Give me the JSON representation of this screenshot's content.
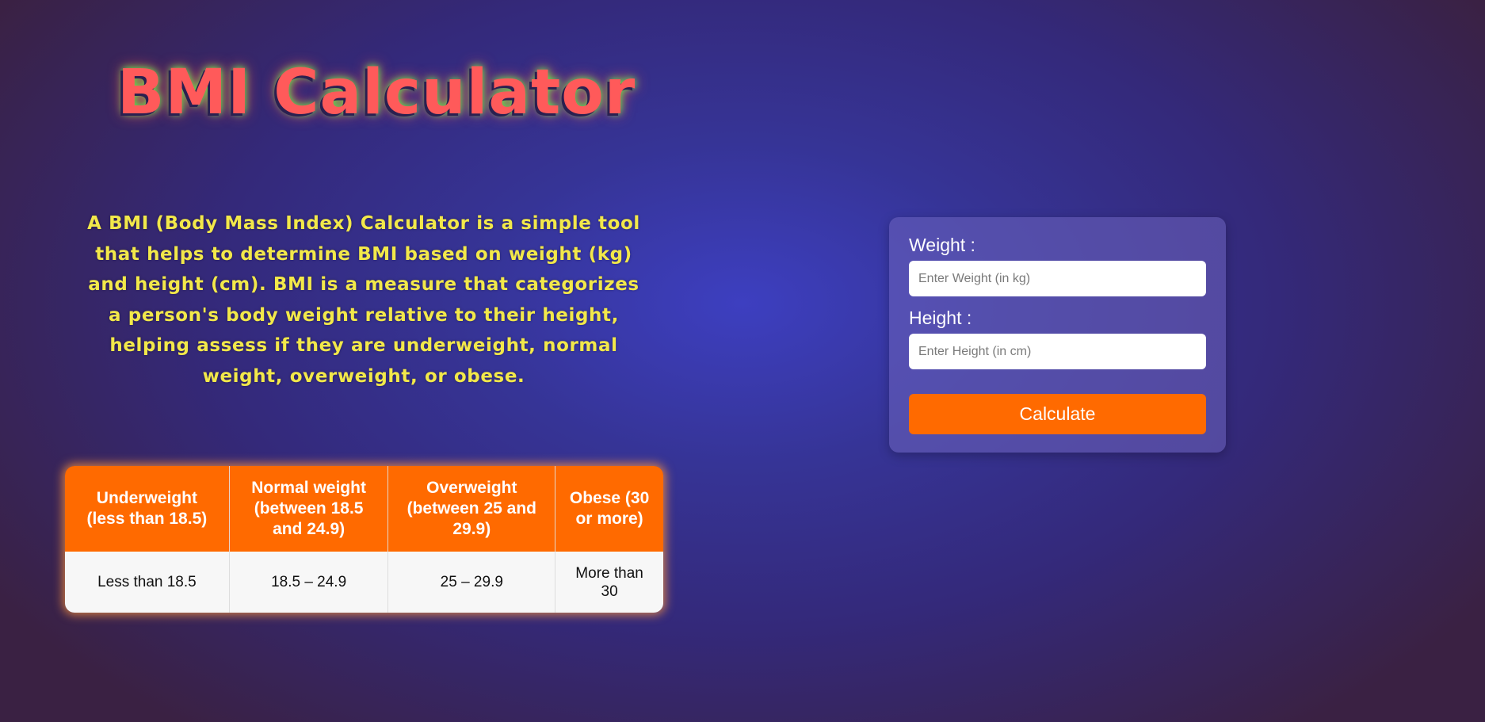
{
  "header": {
    "title": "BMI Calculator"
  },
  "intro": {
    "description": "A BMI (Body Mass Index) Calculator is a simple tool that helps to determine BMI based on weight (kg) and height (cm). BMI is a measure that categorizes a person's body weight relative to their height, helping assess if they are underweight, normal weight, overweight, or obese."
  },
  "bmi_table": {
    "headers": [
      "Underweight (less than 18.5)",
      "Normal weight (between 18.5 and 24.9)",
      "Overweight (between 25 and 29.9)",
      "Obese (30 or more)"
    ],
    "row": [
      "Less than 18.5",
      "18.5 – 24.9",
      "25 – 29.9",
      "More than 30"
    ]
  },
  "form": {
    "weight_label": "Weight :",
    "weight_value": "",
    "weight_placeholder": "Enter Weight (in kg)",
    "height_label": "Height :",
    "height_value": "",
    "height_placeholder": "Enter Height (in cm)",
    "calculate_label": "Calculate"
  },
  "colors": {
    "accent": "#ff6a00",
    "title": "#ff5a5a",
    "description_text": "#f2e84a",
    "background_center": "#3d3fc0",
    "background_edge": "#3a2143"
  }
}
